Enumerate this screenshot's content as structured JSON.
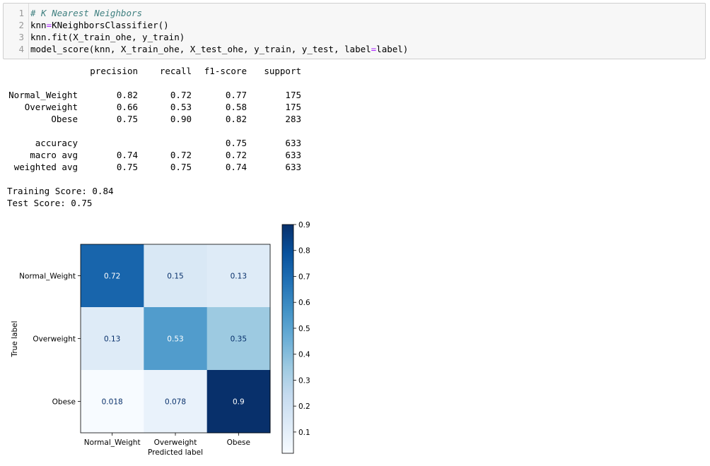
{
  "code_cell": {
    "line_numbers": [
      "1",
      "2",
      "3",
      "4"
    ],
    "lines": [
      [
        {
          "t": "# K Nearest Neighbors",
          "c": "cm"
        }
      ],
      [
        {
          "t": "knn",
          "c": ""
        },
        {
          "t": "=",
          "c": "op"
        },
        {
          "t": "KNeighborsClassifier()",
          "c": ""
        }
      ],
      [
        {
          "t": "knn.fit(X_train_ohe, y_train)",
          "c": ""
        }
      ],
      [
        {
          "t": "model_score(knn, X_train_ohe, X_test_ohe, y_train, y_test, label",
          "c": ""
        },
        {
          "t": "=",
          "c": "op"
        },
        {
          "t": "label)",
          "c": ""
        }
      ]
    ]
  },
  "report": {
    "headers": [
      "precision",
      "recall",
      "f1-score",
      "support"
    ],
    "rows": [
      {
        "label": "Normal_Weight",
        "precision": "0.82",
        "recall": "0.72",
        "f1": "0.77",
        "support": "175"
      },
      {
        "label": "Overweight",
        "precision": "0.66",
        "recall": "0.53",
        "f1": "0.58",
        "support": "175"
      },
      {
        "label": "Obese",
        "precision": "0.75",
        "recall": "0.90",
        "f1": "0.82",
        "support": "283"
      },
      {
        "label": "",
        "precision": "",
        "recall": "",
        "f1": "",
        "support": ""
      },
      {
        "label": "accuracy",
        "precision": "",
        "recall": "",
        "f1": "0.75",
        "support": "633"
      },
      {
        "label": "macro avg",
        "precision": "0.74",
        "recall": "0.72",
        "f1": "0.72",
        "support": "633"
      },
      {
        "label": "weighted avg",
        "precision": "0.75",
        "recall": "0.75",
        "f1": "0.74",
        "support": "633"
      }
    ]
  },
  "scores": {
    "training": "Training Score: 0.84",
    "test": "Test Score: 0.75"
  },
  "chart_data": {
    "type": "heatmap",
    "title": "",
    "xlabel": "Predicted label",
    "ylabel": "True label",
    "x_categories": [
      "Normal_Weight",
      "Overweight",
      "Obese"
    ],
    "y_categories": [
      "Normal_Weight",
      "Overweight",
      "Obese"
    ],
    "values": [
      [
        0.72,
        0.15,
        0.13
      ],
      [
        0.13,
        0.53,
        0.35
      ],
      [
        0.018,
        0.078,
        0.9
      ]
    ],
    "value_labels": [
      [
        "0.72",
        "0.15",
        "0.13"
      ],
      [
        "0.13",
        "0.53",
        "0.35"
      ],
      [
        "0.018",
        "0.078",
        "0.9"
      ]
    ],
    "colormap": "Blues",
    "colorbar_range": [
      0.018,
      0.9
    ],
    "colorbar_ticks": [
      0.1,
      0.2,
      0.3,
      0.4,
      0.5,
      0.6,
      0.7,
      0.8,
      0.9
    ],
    "colorbar_tick_labels": [
      "0.1",
      "0.2",
      "0.3",
      "0.4",
      "0.5",
      "0.6",
      "0.7",
      "0.8",
      "0.9"
    ],
    "grid": false,
    "legend": "colorbar-right"
  }
}
